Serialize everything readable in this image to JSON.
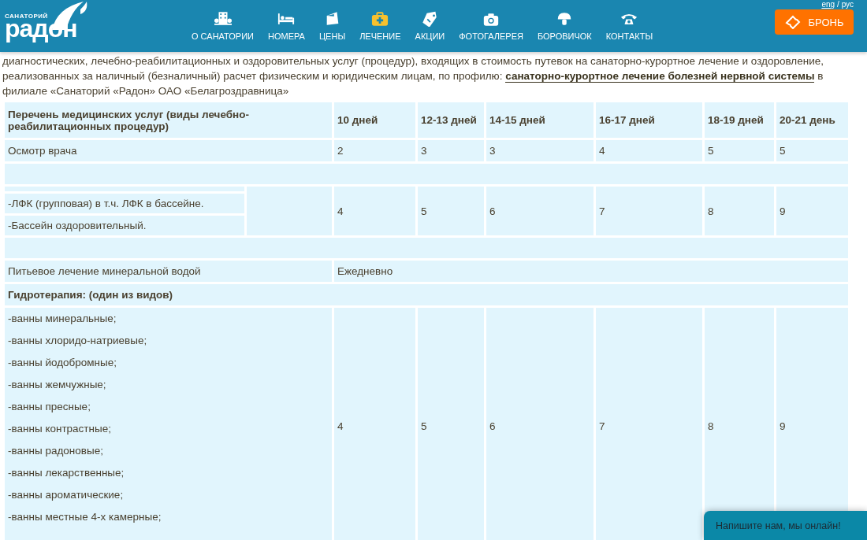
{
  "header": {
    "logo": {
      "small": "САНАТОРИЙ",
      "big": "радон"
    },
    "nav": [
      {
        "label": "О САНАТОРИИ",
        "selected": false
      },
      {
        "label": "НОМЕРА",
        "selected": false
      },
      {
        "label": "ЦЕНЫ",
        "selected": false
      },
      {
        "label": "ЛЕЧЕНИЕ",
        "selected": true
      },
      {
        "label": "АКЦИИ",
        "selected": false
      },
      {
        "label": "ФОТОГАЛЕРЕЯ",
        "selected": false
      },
      {
        "label": "БОРОВИЧОК",
        "selected": false
      },
      {
        "label": "КОНТАКТЫ",
        "selected": false
      }
    ],
    "languages": [
      {
        "label": "eng",
        "selected": false
      },
      {
        "label": "/ рус",
        "selected": true
      }
    ],
    "booking_button": "БРОНЬ"
  },
  "intro": {
    "before": "диагностических, лечебно-реабилитационных и оздоровительных услуг (процедур), входящих в стоимость путевок на санаторно-курортное лечение и оздоровление, реализованных за наличный (безналичный) расчет физическим и юридическим лицам, по профилю: ",
    "link": "санаторно-курортное лечение болезней нервной системы",
    "after": " в филиале «Санаторий «Радон» ОАО «Белагроздравница»"
  },
  "table": {
    "heading": "Перечень медицинских услуг (виды лечебно-реабилитационных процедур)",
    "columns": [
      "10 дней",
      "12-13 дней",
      "14-15 дней",
      "16-17 дней",
      "18-19 дней",
      "20-21 день"
    ],
    "rows": [
      {
        "kind": "values",
        "label": "Осмотр врача",
        "values": [
          "2",
          "3",
          "3",
          "4",
          "5",
          "5"
        ]
      },
      {
        "kind": "blank"
      },
      {
        "kind": "group",
        "items": [
          "-ЛФК (групповая) в т.ч. ЛФК в бассейне.",
          "-Бассейн оздоровительный."
        ],
        "values": [
          "4",
          "5",
          "6",
          "7",
          "8",
          "9"
        ]
      },
      {
        "kind": "blank"
      },
      {
        "kind": "span",
        "label": "Питьевое лечение минеральной водой",
        "text": "Ежедневно"
      },
      {
        "kind": "section",
        "label": "Гидротерапия: (один из видов)"
      },
      {
        "kind": "list",
        "items": [
          "-ванны минеральные;",
          "-ванны хлоридо-натриевые;",
          "-ванны йодобромные;",
          "-ванны жемчужные;",
          "-ванны пресные;",
          "-ванны контрастные;",
          "-ванны радоновые;",
          "-ванны лекарственные;",
          "-ванны ароматические;",
          "-ванны местные 4-х камерные;"
        ],
        "values": [
          "4",
          "5",
          "6",
          "7",
          "8",
          "9"
        ]
      }
    ]
  },
  "chat": {
    "text": "Напишите нам, мы онлайн!"
  }
}
